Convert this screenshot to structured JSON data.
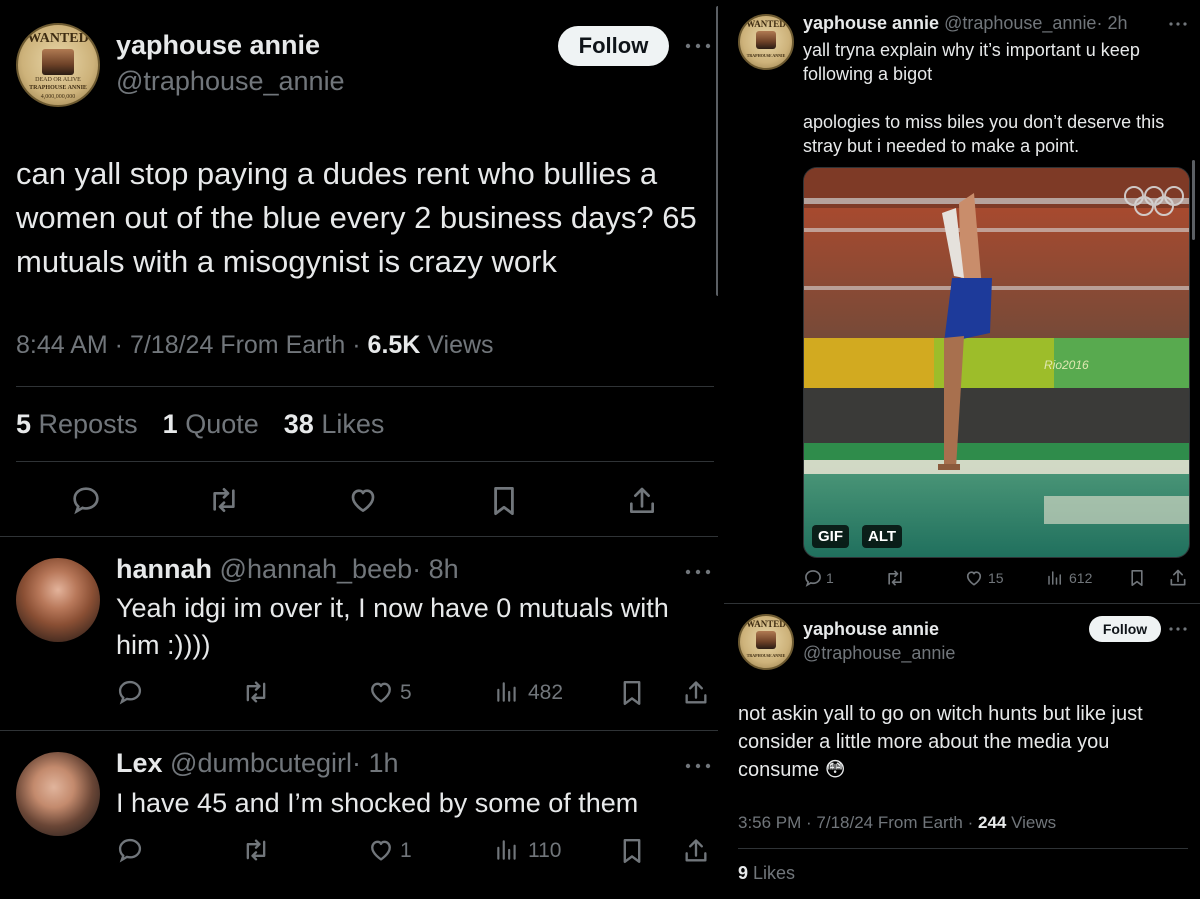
{
  "left": {
    "main_tweet": {
      "author_name": "yaphouse annie",
      "author_handle": "@traphouse_annie",
      "follow_label": "Follow",
      "avatar": {
        "top_text": "WANTED",
        "mid_text": "DEAD OR ALIVE",
        "name_text": "TRAPHOUSE ANNIE",
        "bounty_text": "4,000,000,000"
      },
      "text": "can yall stop paying a dudes rent who bullies a women out of the blue every 2 business days? 65 mutuals with a misogynist is crazy work",
      "meta_time": "8:44 AM · 7/18/24 From Earth · ",
      "views_count": "6.5K",
      "views_label": " Views",
      "reposts_count": "5",
      "reposts_label": "Reposts",
      "quotes_count": "1",
      "quotes_label": "Quote",
      "likes_count": "38",
      "likes_label": "Likes"
    },
    "replies": [
      {
        "name": "hannah",
        "handle": "@hannah_beeb",
        "time": "· 8h",
        "text": "Yeah idgi im over it, I now have 0 mutuals with him :))))",
        "likes": "5",
        "views": "482"
      },
      {
        "name": "Lex",
        "handle": "@dumbcutegirl",
        "time": "· 1h",
        "text": "I have 45 and I’m shocked by some of them",
        "likes": "1",
        "views": "110"
      }
    ]
  },
  "right": {
    "tweet1": {
      "author_name": "yaphouse annie",
      "author_handle": "@traphouse_annie",
      "time": "· 2h",
      "text1": "yall tryna explain why it’s important u keep following a bigot",
      "text2": "apologies to miss biles you don’t deserve this stray but i needed to make a point.",
      "media_tag_gif": "GIF",
      "media_tag_alt": "ALT",
      "media_banner": "Rio2016",
      "replies": "1",
      "likes": "15",
      "views": "612"
    },
    "tweet2": {
      "author_name": "yaphouse annie",
      "author_handle": "@traphouse_annie",
      "follow_label": "Follow",
      "text": "not askin yall to go on witch hunts but like just consider a little more about the media you consume",
      "emoji": "😳",
      "meta_time": "3:56 PM · 7/18/24 From Earth · ",
      "views_count": "244",
      "views_label": " Views",
      "likes_count": "9",
      "likes_label": " Likes"
    }
  }
}
